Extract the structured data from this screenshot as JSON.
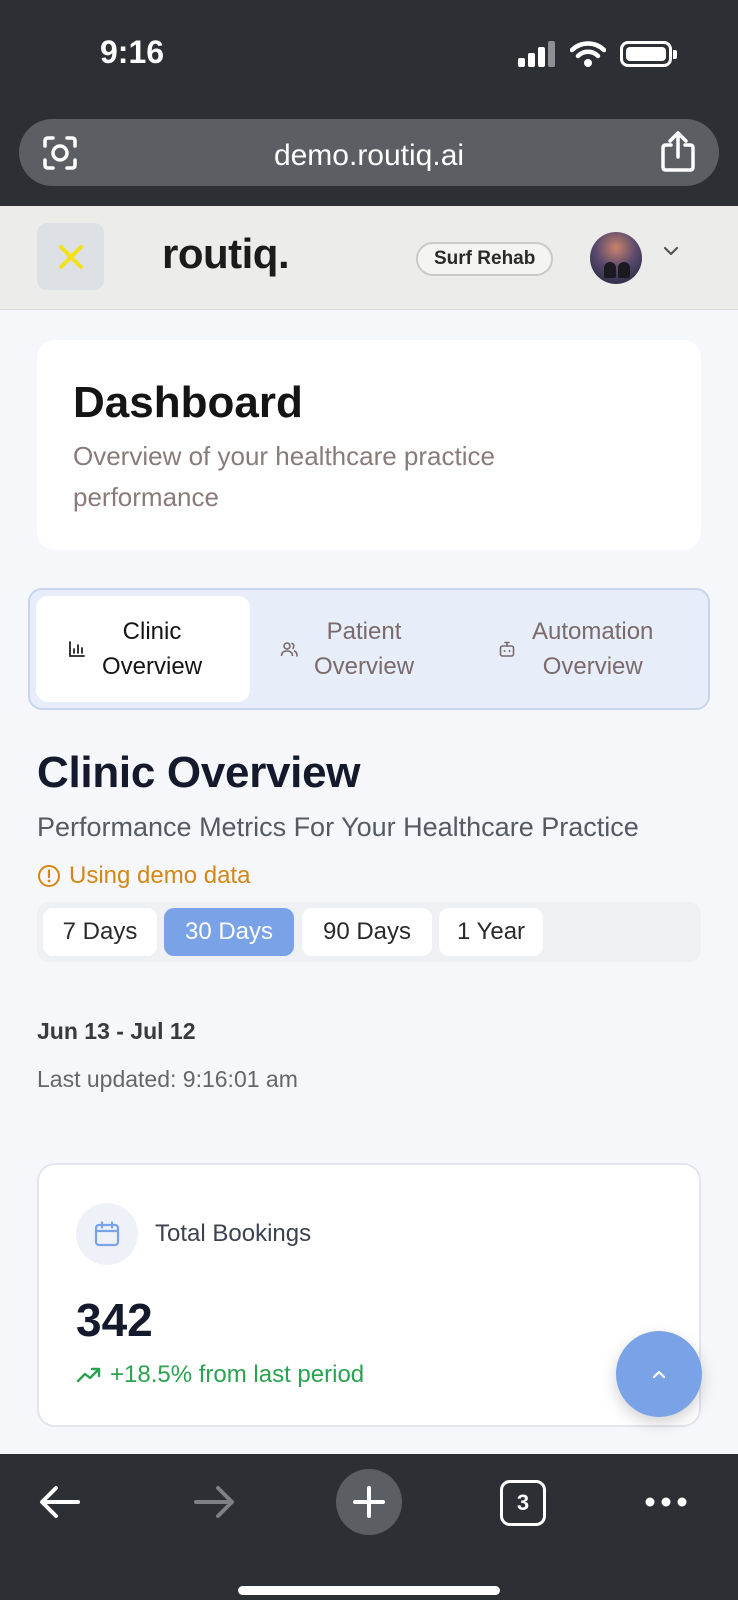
{
  "status_bar": {
    "time": "9:16"
  },
  "browser": {
    "url": "demo.routiq.ai",
    "tab_count": "3"
  },
  "header": {
    "brand": "routiq.",
    "clinic": "Surf Rehab"
  },
  "page": {
    "title": "Dashboard",
    "subtitle": "Overview of your healthcare practice performance"
  },
  "tabs": [
    {
      "label_line1": "Clinic",
      "label_line2": "Overview",
      "icon": "bar-chart-icon",
      "active": true
    },
    {
      "label_line1": "Patient",
      "label_line2": "Overview",
      "icon": "users-icon",
      "active": false
    },
    {
      "label_line1": "Automation",
      "label_line2": "Overview",
      "icon": "bot-icon",
      "active": false
    }
  ],
  "section": {
    "title": "Clinic Overview",
    "subtitle": "Performance Metrics For Your Healthcare Practice",
    "demo_notice": "Using demo data"
  },
  "ranges": [
    {
      "label": "7 Days",
      "selected": false
    },
    {
      "label": "30 Days",
      "selected": true
    },
    {
      "label": "90 Days",
      "selected": false
    },
    {
      "label": "1 Year",
      "selected": false
    }
  ],
  "period": {
    "dates": "Jun 13 - Jul 12",
    "last_updated": "Last updated: 9:16:01 am"
  },
  "metric": {
    "label": "Total Bookings",
    "value": "342",
    "trend": "+18.5% from last period",
    "icon": "calendar-icon"
  },
  "colors": {
    "accent": "#7aa2e6",
    "warning": "#d48717",
    "positive": "#2aa350",
    "menu_x": "#f2e21a"
  }
}
